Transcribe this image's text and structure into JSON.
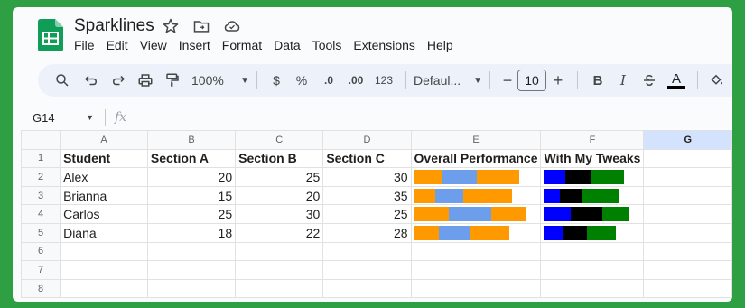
{
  "app": {
    "title": "Sparklines",
    "menu": [
      "File",
      "Edit",
      "View",
      "Insert",
      "Format",
      "Data",
      "Tools",
      "Extensions",
      "Help"
    ]
  },
  "toolbar": {
    "zoom": "100%",
    "currency": "$",
    "percent": "%",
    "dec_decrease": ".0",
    "dec_increase": ".00",
    "number_format": "123",
    "font": "Defaul...",
    "font_size": "10",
    "minus": "−",
    "plus": "+",
    "bold": "B",
    "italic": "I",
    "text_color": "A"
  },
  "formula_bar": {
    "cell": "G14",
    "fx": "fx"
  },
  "columns": [
    "A",
    "B",
    "C",
    "D",
    "E",
    "F",
    "G"
  ],
  "rows": [
    {
      "n": "1",
      "cells": [
        "Student",
        "Section A",
        "Section B",
        "Section C",
        "Overall Performance",
        "With My Tweaks"
      ]
    },
    {
      "n": "2",
      "cells": [
        "Alex",
        "20",
        "25",
        "30"
      ]
    },
    {
      "n": "3",
      "cells": [
        "Brianna",
        "15",
        "20",
        "35"
      ]
    },
    {
      "n": "4",
      "cells": [
        "Carlos",
        "25",
        "30",
        "25"
      ]
    },
    {
      "n": "5",
      "cells": [
        "Diana",
        "18",
        "22",
        "28"
      ]
    },
    {
      "n": "6",
      "cells": []
    },
    {
      "n": "7",
      "cells": []
    },
    {
      "n": "8",
      "cells": []
    }
  ],
  "sparkline_colors": {
    "overall": [
      "#ff9900",
      "#6d9eeb",
      "#ff9900"
    ],
    "tweaks": [
      "#0000ff",
      "#000000",
      "#008000"
    ]
  },
  "sparkline_data": [
    [
      20,
      25,
      30
    ],
    [
      15,
      20,
      35
    ],
    [
      25,
      30,
      25
    ],
    [
      18,
      22,
      28
    ]
  ]
}
